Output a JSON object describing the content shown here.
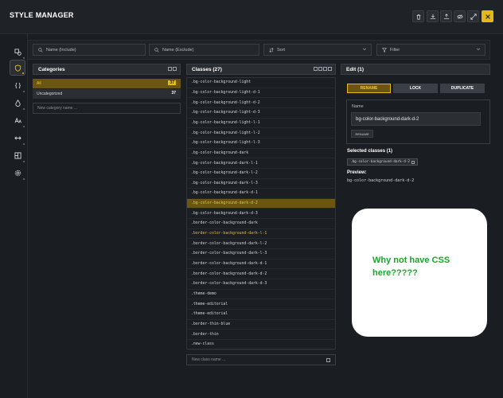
{
  "app": {
    "title": "STYLE MANAGER"
  },
  "toolbar": {
    "buttons": [
      {
        "icon": "trash-icon"
      },
      {
        "icon": "download-icon"
      },
      {
        "icon": "upload-icon"
      },
      {
        "icon": "eye-off-icon"
      },
      {
        "icon": "expand-icon"
      },
      {
        "icon": "close-icon"
      }
    ],
    "accent": "#e5b917"
  },
  "sidebar": {
    "items": [
      {
        "icon": "shapes-icon"
      },
      {
        "icon": "shield-icon"
      },
      {
        "icon": "braces-icon"
      },
      {
        "icon": "drop-icon"
      },
      {
        "icon": "font-size-icon"
      },
      {
        "icon": "arrows-horizontal-icon"
      },
      {
        "icon": "layout-icon"
      },
      {
        "icon": "settings-icon"
      }
    ]
  },
  "filters": {
    "name_include_placeholder": "Name (Include)",
    "name_exclude_placeholder": "Name (Exclude)",
    "sort_label": "Sort",
    "filter_label": "Filter"
  },
  "categories": {
    "title": "Categories",
    "items": [
      {
        "label": "All",
        "count": "37"
      },
      {
        "label": "Uncategorized",
        "count": "37"
      }
    ],
    "new_placeholder": "New category name ..."
  },
  "classes": {
    "title": "Classes (27)",
    "items": [
      ".bg-color-background-light",
      ".bg-color-background-light-d-1",
      ".bg-color-background-light-d-2",
      ".bg-color-background-light-d-3",
      ".bg-color-background-light-l-1",
      ".bg-color-background-light-l-2",
      ".bg-color-background-light-l-3",
      ".bg-color-background-dark",
      ".bg-color-background-dark-l-1",
      ".bg-color-background-dark-l-2",
      ".bg-color-background-dark-l-3",
      ".bg-color-background-dark-d-1",
      ".bg-color-background-dark-d-2",
      ".bg-color-background-dark-d-3",
      ".border-color-background-dark",
      ".border-color-background-dark-l-1",
      ".border-color-background-dark-l-2",
      ".border-color-background-dark-l-3",
      ".border-color-background-dark-d-1",
      ".border-color-background-dark-d-2",
      ".border-color-background-dark-d-3",
      ".theme-demo",
      ".theme-editorial",
      ".theme-editorial",
      ".border-thin-blue",
      ".border-thin",
      ".new-class"
    ],
    "new_placeholder": "New class name ..."
  },
  "edit": {
    "title": "Edit (1)",
    "tabs": [
      "RENAME",
      "LOCK",
      "DUPLICATE"
    ],
    "name_label": "Name",
    "name_value": "bg-color-background-dark-d-2",
    "rename_button": "RENAME",
    "selected_title": "Selected classes (1)",
    "selected_chip": ".bg-color-background-dark-d-2",
    "preview_title": "Preview:",
    "preview_value": "bg-color-background-dark-d-2"
  },
  "note": {
    "text": "Why not have CSS here?????"
  }
}
